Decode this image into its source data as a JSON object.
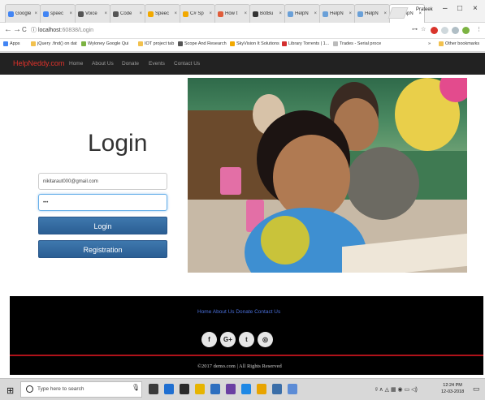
{
  "browser": {
    "tabs": [
      {
        "title": "Google",
        "color": "#4285f4"
      },
      {
        "title": "speec",
        "color": "#4285f4"
      },
      {
        "title": "Voice",
        "color": "#555555"
      },
      {
        "title": "Code",
        "color": "#555555"
      },
      {
        "title": "Speec",
        "color": "#f2a900"
      },
      {
        "title": "C# Sp",
        "color": "#f2a900"
      },
      {
        "title": "How t",
        "color": "#e05d3b"
      },
      {
        "title": "BotBu",
        "color": "#333333"
      },
      {
        "title": "HelpN",
        "color": "#6aa0d8"
      },
      {
        "title": "HelpN",
        "color": "#6aa0d8"
      },
      {
        "title": "HelpN",
        "color": "#6aa0d8"
      },
      {
        "title": "HelpN",
        "color": "#6aa0d8"
      }
    ],
    "tab_close": "×",
    "user_name": "Prateek",
    "window_controls": {
      "minimize": "–",
      "maximize": "□",
      "close": "×"
    },
    "back_icon": "←",
    "forward_icon": "→",
    "reload_icon": "C",
    "info_icon": "ⓘ",
    "url_host": "localhost",
    "url_path": ":60838/Login",
    "addr_icons": {
      "key": "⊶",
      "star": "☆",
      "menu": "⋮"
    },
    "bookmarks": [
      {
        "label": "Apps",
        "color": "#4285f4"
      },
      {
        "label": "jQuery .find() on dat",
        "color": "#f2c14e"
      },
      {
        "label": "Wyloney Google Qui",
        "color": "#7cb342"
      },
      {
        "label": "IOT project tab",
        "color": "#f2c14e"
      },
      {
        "label": "Scope And Research",
        "color": "#555555"
      },
      {
        "label": "SkyVision It Solutions",
        "color": "#f2a900"
      },
      {
        "label": "Library Torrents | 1...",
        "color": "#d32f2f"
      },
      {
        "label": "Trades - Serial proce",
        "color": "#bbbbbb"
      }
    ],
    "bookmarks_more": "»",
    "other_bookmarks": "Other bookmarks"
  },
  "site": {
    "brand": "HelpNeddy.com",
    "nav": [
      "Home",
      "About Us",
      "Donate",
      "Events",
      "Contact Us"
    ]
  },
  "login": {
    "title": "Login",
    "email_value": "nikitaraut000@gmail.com",
    "password_value": "•••",
    "login_button": "Login",
    "register_button": "Registration"
  },
  "footer": {
    "links": "Home About Us Donate Contact Us",
    "social": [
      {
        "name": "facebook",
        "glyph": "f"
      },
      {
        "name": "google-plus",
        "glyph": "G+"
      },
      {
        "name": "twitter",
        "glyph": "t"
      },
      {
        "name": "instagram",
        "glyph": "◎"
      }
    ],
    "copyright": "©2017  demo.com  |  All  Rights  Reserved"
  },
  "taskbar": {
    "start_icon": "⊞",
    "search_placeholder": "Type here to search",
    "mic_icon": "🎙",
    "apps": [
      {
        "name": "task-view",
        "color": "#3a3a3a"
      },
      {
        "name": "edge",
        "color": "#1f6fd1"
      },
      {
        "name": "store",
        "color": "#2a2a2a"
      },
      {
        "name": "explorer",
        "color": "#e6b400"
      },
      {
        "name": "photos",
        "color": "#2d6fbf"
      },
      {
        "name": "vs",
        "color": "#6a3fa3"
      },
      {
        "name": "mail",
        "color": "#1e88e5"
      },
      {
        "name": "chrome",
        "color": "#e8a400"
      },
      {
        "name": "app",
        "color": "#3b6ea8"
      },
      {
        "name": "notepad",
        "color": "#5c8cd6"
      }
    ],
    "tray_icons": "ᵍ ∧ ◬ ▦ ◉ ▭ ◁)",
    "time": "12:24 PM",
    "date": "12-03-2018",
    "notification_icon": "▭"
  }
}
